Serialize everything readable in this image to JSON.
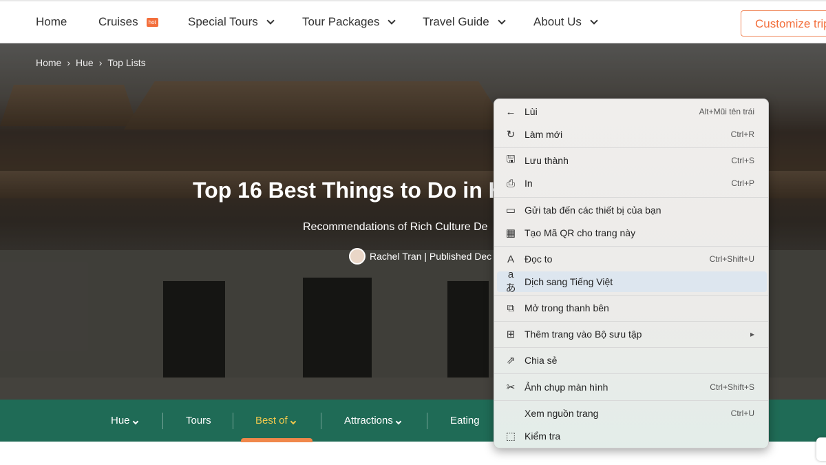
{
  "nav": {
    "items": [
      {
        "label": "Home"
      },
      {
        "label": "Cruises",
        "badge": "hot"
      },
      {
        "label": "Special Tours"
      },
      {
        "label": "Tour Packages"
      },
      {
        "label": "Travel Guide"
      },
      {
        "label": "About Us"
      }
    ],
    "cta": "Customize trip"
  },
  "hero": {
    "breadcrumb": [
      "Home",
      "Hue",
      "Top Lists"
    ],
    "title": "Top 16 Best Things to Do in H",
    "subtitle": "Recommendations of Rich Culture De",
    "author": "Rachel Tran | Published Dec"
  },
  "subnav": {
    "items": [
      "Hue",
      "Tours",
      "Best of",
      "Attractions",
      "Eating"
    ],
    "active": "Best of",
    "accent": "#f2c94c",
    "bg": "#1f6b56"
  },
  "context_menu": {
    "items": [
      {
        "icon": "back-arrow-icon",
        "label": "Lùi",
        "shortcut": "Alt+Mũi tên trái"
      },
      {
        "icon": "refresh-icon",
        "label": "Làm mới",
        "shortcut": "Ctrl+R"
      },
      {
        "icon": "save-icon",
        "label": "Lưu thành",
        "shortcut": "Ctrl+S"
      },
      {
        "icon": "printer-icon",
        "label": "In",
        "shortcut": "Ctrl+P"
      },
      {
        "icon": "devices-icon",
        "label": "Gửi tab đến các thiết bị của bạn",
        "shortcut": ""
      },
      {
        "icon": "qr-code-icon",
        "label": "Tạo Mã QR cho trang này",
        "shortcut": ""
      },
      {
        "icon": "read-aloud-icon",
        "label": "Đọc to",
        "shortcut": "Ctrl+Shift+U"
      },
      {
        "icon": "translate-icon",
        "label": "Dịch sang Tiếng Việt",
        "shortcut": ""
      },
      {
        "icon": "sidebar-icon",
        "label": "Mở trong thanh bên",
        "shortcut": ""
      },
      {
        "icon": "collections-icon",
        "label": "Thêm trang vào Bộ sưu tập",
        "shortcut": "▸"
      },
      {
        "icon": "share-icon",
        "label": "Chia sẻ",
        "shortcut": ""
      },
      {
        "icon": "screenshot-icon",
        "label": "Ảnh chụp màn hình",
        "shortcut": "Ctrl+Shift+S"
      },
      {
        "icon": "",
        "label": "Xem nguồn trang",
        "shortcut": "Ctrl+U"
      },
      {
        "icon": "inspect-icon",
        "label": "Kiểm tra",
        "shortcut": ""
      }
    ]
  }
}
